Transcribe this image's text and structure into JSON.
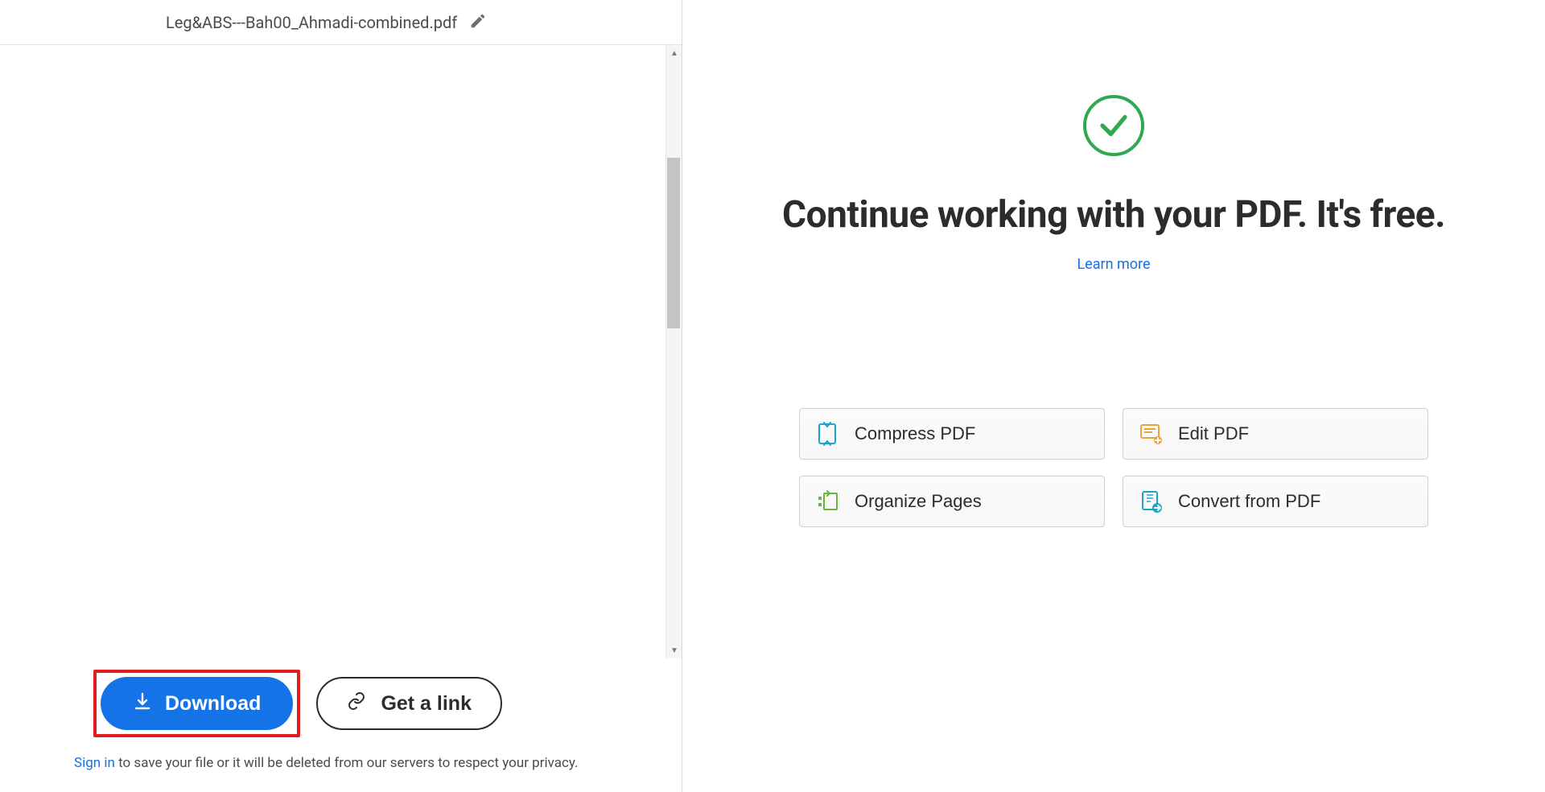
{
  "header": {
    "filename": "Leg&ABS---Bah00_Ahmadi-combined.pdf"
  },
  "footer": {
    "download_label": "Download",
    "link_label": "Get a link",
    "signin_label": "Sign in",
    "signin_rest": " to save your file or it will be deleted from our servers to respect your privacy."
  },
  "right": {
    "heading": "Continue working with your PDF. It's free.",
    "learn_more": "Learn more",
    "tools": {
      "compress": "Compress PDF",
      "edit": "Edit PDF",
      "organize": "Organize Pages",
      "convert": "Convert from PDF"
    }
  }
}
